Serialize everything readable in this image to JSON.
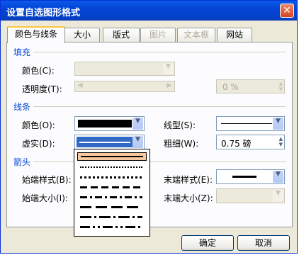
{
  "window": {
    "title": "设置自选图形格式"
  },
  "tabs": [
    {
      "label": "颜色与线条"
    },
    {
      "label": "大小"
    },
    {
      "label": "版式"
    },
    {
      "label": "图片"
    },
    {
      "label": "文本框"
    },
    {
      "label": "网站"
    }
  ],
  "fill": {
    "section": "填充",
    "color_label": "颜色(C):",
    "transparency_label": "透明度(T):",
    "transparency_value": "0 %"
  },
  "line": {
    "section": "线条",
    "color_label": "颜色(O):",
    "dash_label": "虚实(D):",
    "style_label": "线型(S):",
    "weight_label": "粗细(W):",
    "weight_value": "0.75 磅",
    "dash_options": [
      "solid",
      "round-dot",
      "square-dot",
      "dash",
      "dash-dot",
      "long-dash",
      "long-dash-dot",
      "long-dash-dot-dot"
    ],
    "selected_dash": "solid"
  },
  "arrows": {
    "section": "箭头",
    "begin_style_label": "始端样式(B):",
    "begin_size_label": "始端大小(I):",
    "end_style_label": "末端样式(E):",
    "end_size_label": "末端大小(Z):"
  },
  "buttons": {
    "ok": "确定",
    "cancel": "取消"
  },
  "colors": {
    "line_color": "#000000",
    "dropdown_selected": "#f7c79d"
  }
}
